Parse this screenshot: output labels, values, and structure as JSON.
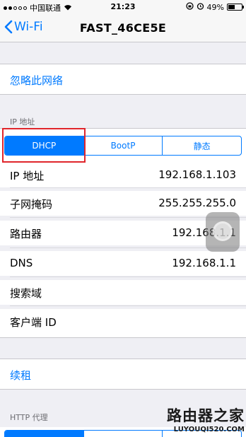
{
  "status_bar": {
    "carrier": "中国联通",
    "time": "21:23",
    "battery": "49%",
    "battery_level": 0.49
  },
  "navbar": {
    "back_label": "Wi-Fi",
    "title": "FAST_46CE5E"
  },
  "forget_network": "忽略此网络",
  "ip_section": {
    "header": "IP 地址",
    "segments": [
      "DHCP",
      "BootP",
      "静态"
    ],
    "selected": "DHCP"
  },
  "rows": [
    {
      "label": "IP 地址",
      "value": "192.168.1.103"
    },
    {
      "label": "子网掩码",
      "value": "255.255.255.0"
    },
    {
      "label": "路由器",
      "value": "192.168.1.1"
    },
    {
      "label": "DNS",
      "value": "192.168.1.1"
    },
    {
      "label": "搜索域",
      "value": ""
    },
    {
      "label": "客户端 ID",
      "value": ""
    }
  ],
  "renew_lease": "续租",
  "http_proxy_header": "HTTP 代理",
  "watermark": {
    "brand": "路由器之家",
    "url": "LUYOUQI520.COM"
  },
  "colors": {
    "accent": "#007aff",
    "highlight_box": "#e0252b",
    "background": "#efeff4"
  }
}
